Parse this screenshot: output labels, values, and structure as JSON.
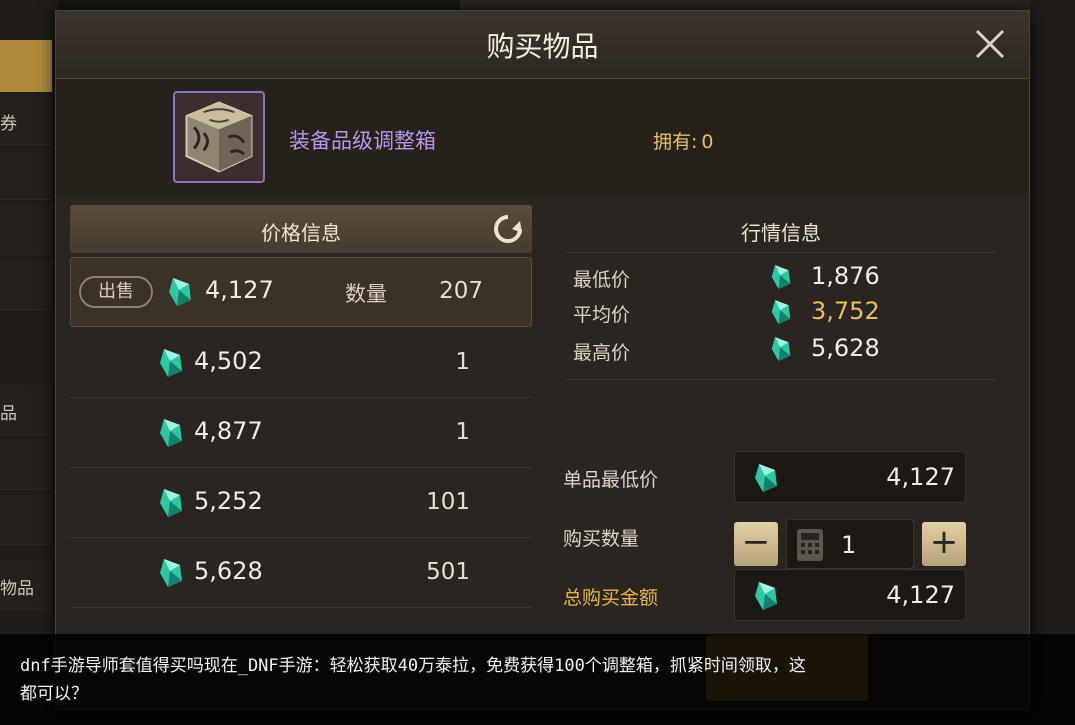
{
  "background": {
    "side_tab_partial": "券",
    "side_items": [
      "品",
      "物品"
    ],
    "top_partial": ""
  },
  "dialog": {
    "title": "购买物品",
    "item": {
      "name": "装备品级调整箱",
      "owned_label": "拥有:",
      "owned_value": "0"
    }
  },
  "price_panel": {
    "header": "价格信息",
    "sell_badge": "出售",
    "qty_label": "数量",
    "rows": [
      {
        "price": "4,127",
        "qty": "207"
      },
      {
        "price": "4,502",
        "qty": "1"
      },
      {
        "price": "4,877",
        "qty": "1"
      },
      {
        "price": "5,252",
        "qty": "101"
      },
      {
        "price": "5,628",
        "qty": "501"
      }
    ]
  },
  "market_panel": {
    "header": "行情信息",
    "stats": [
      {
        "label": "最低价",
        "value": "1,876"
      },
      {
        "label": "平均价",
        "value": "3,752"
      },
      {
        "label": "最高价",
        "value": "5,628"
      }
    ]
  },
  "purchase_form": {
    "unit_min_label": "单品最低价",
    "unit_min_value": "4,127",
    "qty_label": "购买数量",
    "qty_value": "1",
    "minus": "−",
    "plus": "+",
    "total_label": "总购买金额",
    "total_value": "4,127"
  },
  "caption": {
    "line1": "dnf手游导师套值得买吗现在_DNF手游：轻松获取40万泰拉，免费获得100个调整箱，抓紧时间领取，这",
    "line2": "都可以？"
  },
  "colors": {
    "accent_gold": "#e8b54a",
    "item_purple": "#b994f0",
    "avg_price": "#e8c060",
    "currency_gem": "#2fc6a4"
  },
  "icons": [
    "close-icon",
    "refresh-icon",
    "crystal-gem-icon",
    "calculator-icon",
    "item-box-icon"
  ]
}
